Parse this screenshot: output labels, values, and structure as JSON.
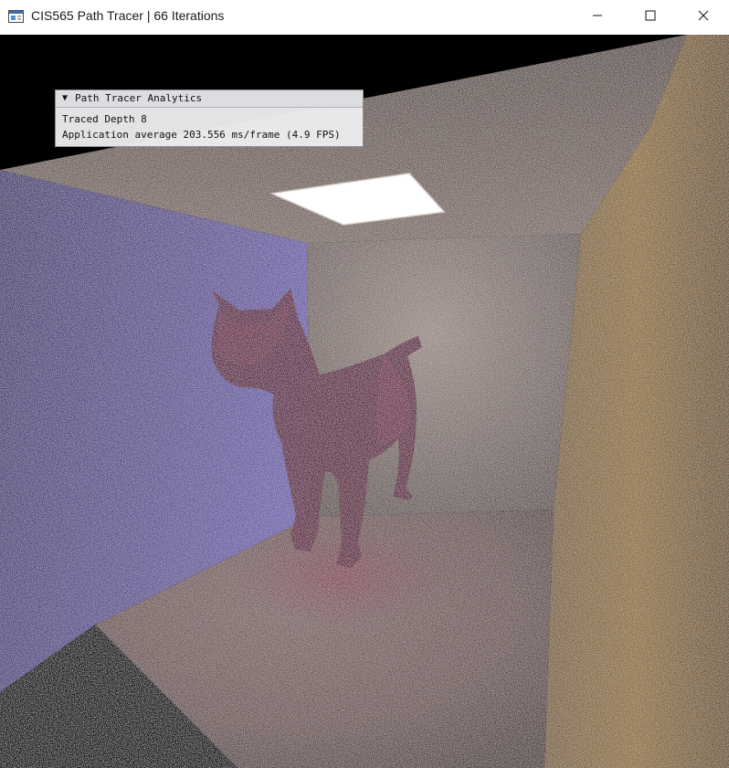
{
  "window": {
    "title": "CIS565 Path Tracer | 66 Iterations",
    "icon": "app-window-icon",
    "controls": {
      "minimize_icon": "minimize-icon",
      "maximize_icon": "maximize-icon",
      "close_icon": "close-icon"
    }
  },
  "analytics": {
    "title": "Path Tracer Analytics",
    "collapse_glyph": "▼",
    "traced_depth": "Traced Depth 8",
    "application_average": "Application average 203.556 ms/frame (4.9 FPS)"
  },
  "render": {
    "scene": "cornell-box",
    "colors": {
      "background": "#000000",
      "left_wall": "#5a4c8c",
      "back_wall": "#7a6d66",
      "right_wall": "#8a6a3a",
      "ceiling": "#6e5e58",
      "floor": "#6a5250",
      "light": "#ffffff",
      "cat": "#5a1e3c"
    }
  }
}
